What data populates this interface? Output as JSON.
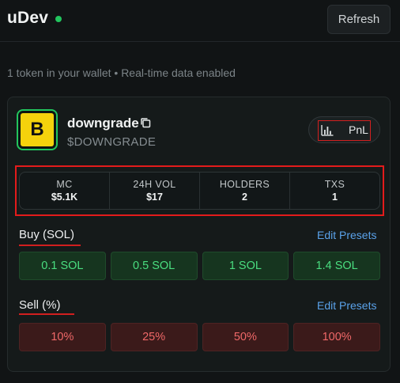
{
  "header": {
    "app_title": "uDev",
    "refresh_label": "Refresh"
  },
  "subtitle": "1 token in your wallet • Real-time data enabled",
  "token": {
    "logo_letter": "B",
    "name": "downgrade",
    "symbol": "$DOWNGRADE",
    "pnl_label": "PnL"
  },
  "stats": [
    {
      "label": "MC",
      "value": "$5.1K"
    },
    {
      "label": "24H VOL",
      "value": "$17"
    },
    {
      "label": "HOLDERS",
      "value": "2"
    },
    {
      "label": "TXS",
      "value": "1"
    }
  ],
  "buy": {
    "title": "Buy (SOL)",
    "edit_label": "Edit Presets",
    "presets": [
      "0.1 SOL",
      "0.5 SOL",
      "1 SOL",
      "1.4 SOL"
    ]
  },
  "sell": {
    "title": "Sell (%)",
    "edit_label": "Edit Presets",
    "presets": [
      "10%",
      "25%",
      "50%",
      "100%"
    ]
  },
  "colors": {
    "accent_green": "#22c55e",
    "link_blue": "#5aa2ea",
    "annotation_red": "#e31b1b"
  },
  "icons": {
    "copy": "copy-icon",
    "chart": "bar-chart-icon",
    "status": "live-status-dot"
  }
}
